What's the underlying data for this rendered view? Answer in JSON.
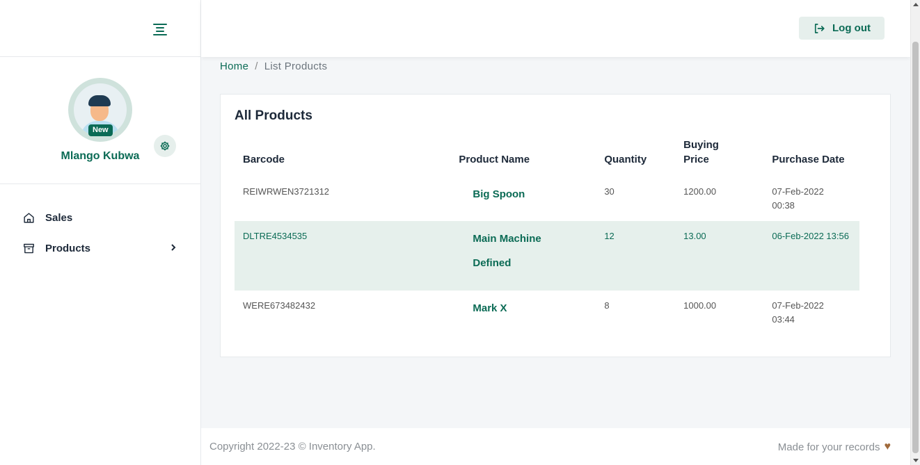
{
  "sidebar": {
    "user_name": "Mlango Kubwa",
    "avatar_badge": "New",
    "items": [
      {
        "label": "Sales",
        "icon": "home-icon"
      },
      {
        "label": "Products",
        "icon": "archive-box-icon"
      }
    ]
  },
  "header": {
    "logout_label": "Log out"
  },
  "breadcrumb": {
    "home": "Home",
    "separator": "/",
    "current": "List Products"
  },
  "products": {
    "title": "All Products",
    "columns": {
      "barcode": "Barcode",
      "name": "Product Name",
      "quantity": "Quantity",
      "buying_price_line1": "Buying",
      "buying_price_line2": "Price",
      "purchase_date": "Purchase Date"
    },
    "rows": [
      {
        "barcode": "REIWRWEN3721312",
        "name": "Big Spoon",
        "quantity": "30",
        "price": "1200.00",
        "date_line1": "07-Feb-2022",
        "date_line2": "00:38"
      },
      {
        "barcode": "DLTRE4534535",
        "name_line1": "Main Machine",
        "name_line2": "Defined",
        "quantity": "12",
        "price": "13.00",
        "date_line1": "06-Feb-2022 13:56"
      },
      {
        "barcode": "WERE673482432",
        "name": "Mark X",
        "quantity": "8",
        "price": "1000.00",
        "date_line1": "07-Feb-2022",
        "date_line2": "03:44"
      }
    ]
  },
  "footer": {
    "copyright": "Copyright 2022-23 © Inventory App.",
    "made_for": "Made for your records"
  },
  "colors": {
    "accent": "#0b6b55",
    "accent_light": "#e6efec",
    "highlight_row": "#e6f0ec"
  }
}
